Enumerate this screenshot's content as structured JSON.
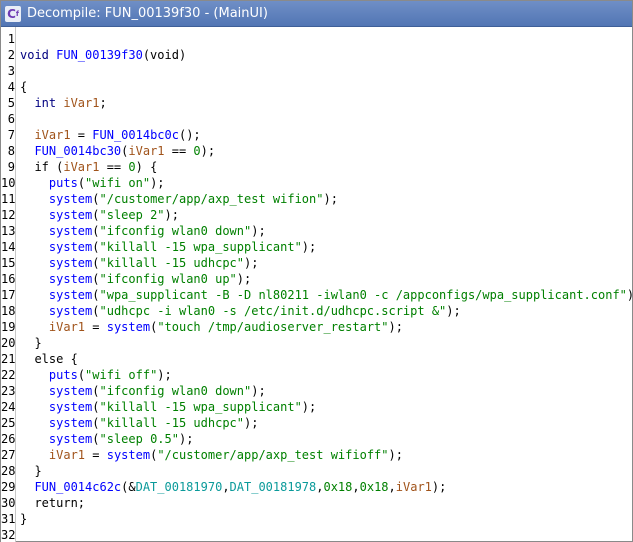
{
  "window": {
    "title": "Decompile: FUN_00139f30 -  (MainUI)",
    "icon": "decompile-icon"
  },
  "lines": [
    {
      "n": "1",
      "tokens": []
    },
    {
      "n": "2",
      "tokens": [
        {
          "t": "void ",
          "c": "kw"
        },
        {
          "t": "FUN_00139f30",
          "c": "fn"
        },
        {
          "t": "(void)",
          "c": ""
        }
      ]
    },
    {
      "n": "3",
      "tokens": []
    },
    {
      "n": "4",
      "tokens": [
        {
          "t": "{",
          "c": ""
        }
      ]
    },
    {
      "n": "5",
      "tokens": [
        {
          "t": "  int ",
          "c": "kw"
        },
        {
          "t": "iVar1",
          "c": "var"
        },
        {
          "t": ";",
          "c": ""
        }
      ]
    },
    {
      "n": "6",
      "tokens": []
    },
    {
      "n": "7",
      "tokens": [
        {
          "t": "  ",
          "c": ""
        },
        {
          "t": "iVar1",
          "c": "var"
        },
        {
          "t": " = ",
          "c": ""
        },
        {
          "t": "FUN_0014bc0c",
          "c": "fn"
        },
        {
          "t": "();",
          "c": ""
        }
      ]
    },
    {
      "n": "8",
      "tokens": [
        {
          "t": "  ",
          "c": ""
        },
        {
          "t": "FUN_0014bc30",
          "c": "fn"
        },
        {
          "t": "(",
          "c": ""
        },
        {
          "t": "iVar1",
          "c": "var"
        },
        {
          "t": " == ",
          "c": ""
        },
        {
          "t": "0",
          "c": "num"
        },
        {
          "t": ");",
          "c": ""
        }
      ]
    },
    {
      "n": "9",
      "tokens": [
        {
          "t": "  if (",
          "c": ""
        },
        {
          "t": "iVar1",
          "c": "var"
        },
        {
          "t": " == ",
          "c": ""
        },
        {
          "t": "0",
          "c": "num"
        },
        {
          "t": ") {",
          "c": ""
        }
      ]
    },
    {
      "n": "10",
      "tokens": [
        {
          "t": "    ",
          "c": ""
        },
        {
          "t": "puts",
          "c": "fn"
        },
        {
          "t": "(",
          "c": ""
        },
        {
          "t": "\"wifi on\"",
          "c": "str"
        },
        {
          "t": ");",
          "c": ""
        }
      ]
    },
    {
      "n": "11",
      "tokens": [
        {
          "t": "    ",
          "c": ""
        },
        {
          "t": "system",
          "c": "fn"
        },
        {
          "t": "(",
          "c": ""
        },
        {
          "t": "\"/customer/app/axp_test wifion\"",
          "c": "str"
        },
        {
          "t": ");",
          "c": ""
        }
      ]
    },
    {
      "n": "12",
      "tokens": [
        {
          "t": "    ",
          "c": ""
        },
        {
          "t": "system",
          "c": "fn"
        },
        {
          "t": "(",
          "c": ""
        },
        {
          "t": "\"sleep 2\"",
          "c": "str"
        },
        {
          "t": ");",
          "c": ""
        }
      ]
    },
    {
      "n": "13",
      "tokens": [
        {
          "t": "    ",
          "c": ""
        },
        {
          "t": "system",
          "c": "fn"
        },
        {
          "t": "(",
          "c": ""
        },
        {
          "t": "\"ifconfig wlan0 down\"",
          "c": "str"
        },
        {
          "t": ");",
          "c": ""
        }
      ]
    },
    {
      "n": "14",
      "tokens": [
        {
          "t": "    ",
          "c": ""
        },
        {
          "t": "system",
          "c": "fn"
        },
        {
          "t": "(",
          "c": ""
        },
        {
          "t": "\"killall -15 wpa_supplicant\"",
          "c": "str"
        },
        {
          "t": ");",
          "c": ""
        }
      ]
    },
    {
      "n": "15",
      "tokens": [
        {
          "t": "    ",
          "c": ""
        },
        {
          "t": "system",
          "c": "fn"
        },
        {
          "t": "(",
          "c": ""
        },
        {
          "t": "\"killall -15 udhcpc\"",
          "c": "str"
        },
        {
          "t": ");",
          "c": ""
        }
      ]
    },
    {
      "n": "16",
      "tokens": [
        {
          "t": "    ",
          "c": ""
        },
        {
          "t": "system",
          "c": "fn"
        },
        {
          "t": "(",
          "c": ""
        },
        {
          "t": "\"ifconfig wlan0 up\"",
          "c": "str"
        },
        {
          "t": ");",
          "c": ""
        }
      ]
    },
    {
      "n": "17",
      "tokens": [
        {
          "t": "    ",
          "c": ""
        },
        {
          "t": "system",
          "c": "fn"
        },
        {
          "t": "(",
          "c": ""
        },
        {
          "t": "\"wpa_supplicant -B -D nl80211 -iwlan0 -c /appconfigs/wpa_supplicant.conf\"",
          "c": "str"
        },
        {
          "t": ");",
          "c": ""
        }
      ]
    },
    {
      "n": "18",
      "tokens": [
        {
          "t": "    ",
          "c": ""
        },
        {
          "t": "system",
          "c": "fn"
        },
        {
          "t": "(",
          "c": ""
        },
        {
          "t": "\"udhcpc -i wlan0 -s /etc/init.d/udhcpc.script &\"",
          "c": "str"
        },
        {
          "t": ");",
          "c": ""
        }
      ]
    },
    {
      "n": "19",
      "tokens": [
        {
          "t": "    ",
          "c": ""
        },
        {
          "t": "iVar1",
          "c": "var"
        },
        {
          "t": " = ",
          "c": ""
        },
        {
          "t": "system",
          "c": "fn"
        },
        {
          "t": "(",
          "c": ""
        },
        {
          "t": "\"touch /tmp/audioserver_restart\"",
          "c": "str"
        },
        {
          "t": ");",
          "c": ""
        }
      ]
    },
    {
      "n": "20",
      "tokens": [
        {
          "t": "  }",
          "c": ""
        }
      ]
    },
    {
      "n": "21",
      "tokens": [
        {
          "t": "  else {",
          "c": ""
        }
      ]
    },
    {
      "n": "22",
      "tokens": [
        {
          "t": "    ",
          "c": ""
        },
        {
          "t": "puts",
          "c": "fn"
        },
        {
          "t": "(",
          "c": ""
        },
        {
          "t": "\"wifi off\"",
          "c": "str"
        },
        {
          "t": ");",
          "c": ""
        }
      ]
    },
    {
      "n": "23",
      "tokens": [
        {
          "t": "    ",
          "c": ""
        },
        {
          "t": "system",
          "c": "fn"
        },
        {
          "t": "(",
          "c": ""
        },
        {
          "t": "\"ifconfig wlan0 down\"",
          "c": "str"
        },
        {
          "t": ");",
          "c": ""
        }
      ]
    },
    {
      "n": "24",
      "tokens": [
        {
          "t": "    ",
          "c": ""
        },
        {
          "t": "system",
          "c": "fn"
        },
        {
          "t": "(",
          "c": ""
        },
        {
          "t": "\"killall -15 wpa_supplicant\"",
          "c": "str"
        },
        {
          "t": ");",
          "c": ""
        }
      ]
    },
    {
      "n": "25",
      "tokens": [
        {
          "t": "    ",
          "c": ""
        },
        {
          "t": "system",
          "c": "fn"
        },
        {
          "t": "(",
          "c": ""
        },
        {
          "t": "\"killall -15 udhcpc\"",
          "c": "str"
        },
        {
          "t": ");",
          "c": ""
        }
      ]
    },
    {
      "n": "26",
      "tokens": [
        {
          "t": "    ",
          "c": ""
        },
        {
          "t": "system",
          "c": "fn"
        },
        {
          "t": "(",
          "c": ""
        },
        {
          "t": "\"sleep 0.5\"",
          "c": "str"
        },
        {
          "t": ");",
          "c": ""
        }
      ]
    },
    {
      "n": "27",
      "tokens": [
        {
          "t": "    ",
          "c": ""
        },
        {
          "t": "iVar1",
          "c": "var"
        },
        {
          "t": " = ",
          "c": ""
        },
        {
          "t": "system",
          "c": "fn"
        },
        {
          "t": "(",
          "c": ""
        },
        {
          "t": "\"/customer/app/axp_test wifioff\"",
          "c": "str"
        },
        {
          "t": ");",
          "c": ""
        }
      ]
    },
    {
      "n": "28",
      "tokens": [
        {
          "t": "  }",
          "c": ""
        }
      ]
    },
    {
      "n": "29",
      "tokens": [
        {
          "t": "  ",
          "c": ""
        },
        {
          "t": "FUN_0014c62c",
          "c": "fn"
        },
        {
          "t": "(&",
          "c": ""
        },
        {
          "t": "DAT_00181970",
          "c": "dat"
        },
        {
          "t": ",",
          "c": ""
        },
        {
          "t": "DAT_00181978",
          "c": "dat"
        },
        {
          "t": ",",
          "c": ""
        },
        {
          "t": "0x18",
          "c": "num"
        },
        {
          "t": ",",
          "c": ""
        },
        {
          "t": "0x18",
          "c": "num"
        },
        {
          "t": ",",
          "c": ""
        },
        {
          "t": "iVar1",
          "c": "var"
        },
        {
          "t": ");",
          "c": ""
        }
      ]
    },
    {
      "n": "30",
      "tokens": [
        {
          "t": "  return;",
          "c": ""
        }
      ]
    },
    {
      "n": "31",
      "tokens": [
        {
          "t": "}",
          "c": ""
        }
      ]
    },
    {
      "n": "32",
      "tokens": []
    }
  ]
}
